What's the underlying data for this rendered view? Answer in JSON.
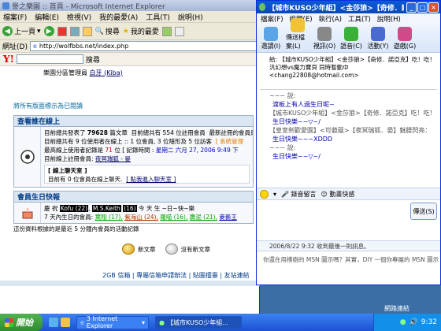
{
  "ie": {
    "title": "譽之樂園 :: 首頁 - Microsoft Internet Explorer",
    "menu": [
      "檔案(F)",
      "編輯(E)",
      "檢視(V)",
      "我的最愛(A)",
      "工具(T)",
      "說明(H)"
    ],
    "toolbar": {
      "back": "上一頁",
      "search": "搜尋",
      "favorites": "我的最愛"
    },
    "address_label": "網址(D)",
    "address_value": "http://wolfbbs.net/index.php",
    "yahoo_logo": "Y!",
    "yahoo_search": "搜尋"
  },
  "forum": {
    "moderator_label": "樂園分區管理員",
    "moderator_name": "白牙 (Kiba)",
    "mark_read": "將所有版面標示為已閱讀",
    "online": {
      "header": "查看誰在線上",
      "line1_a": "目前總共發表了",
      "posts": "79628",
      "line1_b": "篇文章",
      "line1_c": "目前總共有 554 位註冊會員",
      "line1_d": "最新註冊的會員是",
      "line2": "目前總共有 9 位使用者在線上 :: 1 位會員, 3 位隱形及 5 位訪客",
      "line2_tag": "[ 系統管理",
      "line3_a": "最高線上使用者記錄是",
      "line3_n": "71",
      "line3_b": "位 [ 記錄時間 :",
      "line3_date": "星期二 六月 27, 2006 9:49 下",
      "line4_a": "目前線上註冊會員:",
      "line4_user": "夜冥瑞狐 - 晏",
      "box_title": "[ 線上聊天室 ]",
      "box_line_a": "目前有 0 位會員在線上聊天.",
      "box_link": "[ 點我進入聊天室 ]"
    },
    "birthday": {
      "header": "會員生日快報",
      "line1_a": "慶 祝",
      "tag1": "Kofu (22)",
      "tag2": "M.S.Keith",
      "tag2_age": "(16)",
      "line1_b": "今 天 生 ~日~快~樂",
      "line2_a": "7 天內生日的會員:",
      "n1": "葉翔 (17),",
      "n2": "紫海山 (24),",
      "n3": "羅喵 (16),",
      "n4": "鷹泥 (21),",
      "n5": "麥藝王"
    },
    "footnote": "這份資料根據的是最近 5 分鐘內會員的活動記錄",
    "legend": {
      "new": "新文章",
      "no_new": "沒有新文章"
    },
    "footer1": "2GB 信箱 | 專屬信箱申請辦法 | 貼圖擂臺 | 友站連結"
  },
  "msn": {
    "title": "【城市KUSO少年組】<金莎狼>【奇修．諾亞克】",
    "menu": [
      "檔案(F)",
      "編輯(E)",
      "執行(A)",
      "工具(T)",
      "說明(H)"
    ],
    "tools": [
      "邀請(I)",
      "傳送檔案(L)",
      "視訊(O)",
      "語音(C)",
      "活動(Y)",
      "遊戲(G)"
    ],
    "to_label": "給:",
    "to_line1": "【城市KUSO少年組】<金莎狼>【奇修．諾亞克】吃！吃！",
    "to_line2": "汎幻想vs魔力寶貝 同時暫動中 <chang22808@hotmail.com>",
    "log": [
      {
        "said": "~~~ 說:",
        "msg": "渡板上有人過生日呢~"
      },
      {
        "said": "【城市KUSO少年組】<金莎狼>【奇修．諾亞克】吃！吃！",
        "msg": "生日快樂~~▽~/"
      },
      {
        "said": "【皇室劍歡愛園】<可藐蘊>【夜冥瑞狐．晏】魅腰閃亮：",
        "msg": "生日快樂~~~XDDD"
      },
      {
        "said": "~~~ 說:",
        "msg": "生日快樂~~▽~/"
      }
    ],
    "emote_bar": {
      "voice": "錄音留言",
      "wink": "動畫快感"
    },
    "send": "傳送(S)",
    "last_msg": "2006/8/22 9:32 收到最後一則訊息。",
    "ad": "你還在用樸樹的 MSN 圖示嗎？其實，DIY 一個你專屬的 MSN 圖示"
  },
  "desktop": {
    "tray_label": "網路連結",
    "start": "開始",
    "tasks": [
      "3 Internet Explorer",
      "【城市KUSO少年組..."
    ],
    "clock": "9:32"
  }
}
